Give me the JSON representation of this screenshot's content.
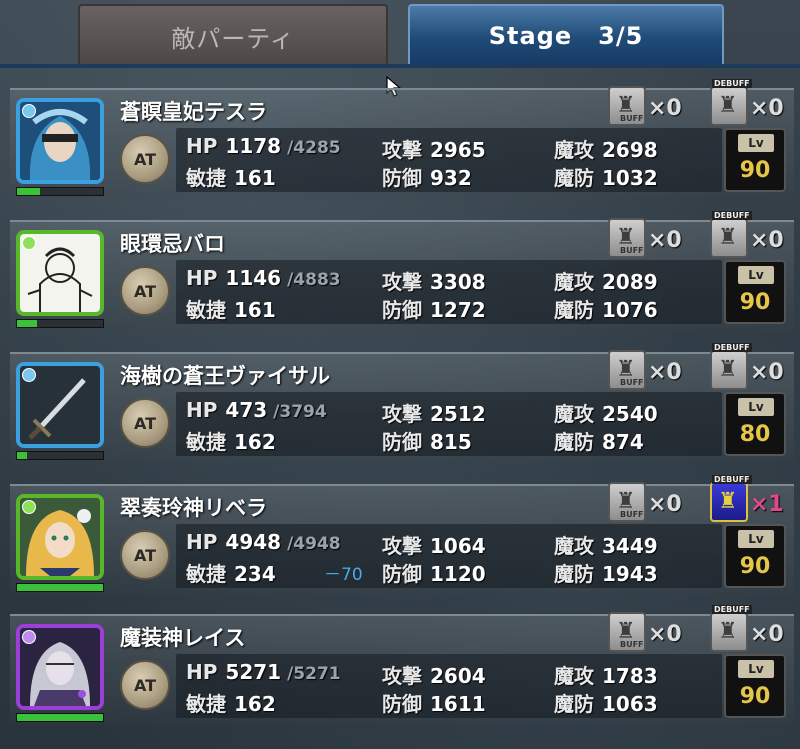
{
  "tabs": {
    "enemy_label": "敵パーティ",
    "stage_label": "Stage",
    "stage_value": "3/5"
  },
  "labels": {
    "hp": "HP",
    "agility": "敏捷",
    "attack": "攻撃",
    "defense": "防御",
    "magic_attack": "魔攻",
    "magic_defense": "魔防",
    "lv": "Lv",
    "at": "AT",
    "buff": "BUFF",
    "debuff": "DEBUFF"
  },
  "units": [
    {
      "name": "蒼瞑皇妃テスラ",
      "hp": "1178",
      "hp_max": "/4285",
      "agility": "161",
      "agility_mod": "",
      "attack": "2965",
      "defense": "932",
      "magic_attack": "2698",
      "magic_defense": "1032",
      "buff": "×0",
      "debuff": "×0",
      "level": "90",
      "hp_ratio": 0.27,
      "frame": "blue",
      "portrait_icon": "blindfolded-woman-portrait-icon"
    },
    {
      "name": "眼環忌バロ",
      "hp": "1146",
      "hp_max": "/4883",
      "agility": "161",
      "agility_mod": "",
      "attack": "3308",
      "defense": "1272",
      "magic_attack": "2089",
      "magic_defense": "1076",
      "buff": "×0",
      "debuff": "×0",
      "level": "90",
      "hp_ratio": 0.23,
      "frame": "green",
      "portrait_icon": "sketch-man-portrait-icon"
    },
    {
      "name": "海樹の蒼王ヴァイサル",
      "hp": "473",
      "hp_max": "/3794",
      "agility": "162",
      "agility_mod": "",
      "attack": "2512",
      "defense": "815",
      "magic_attack": "2540",
      "magic_defense": "874",
      "buff": "×0",
      "debuff": "×0",
      "level": "80",
      "hp_ratio": 0.12,
      "frame": "blue",
      "portrait_icon": "sword-portrait-icon"
    },
    {
      "name": "翠奏玲神リベラ",
      "hp": "4948",
      "hp_max": "/4948",
      "agility": "234",
      "agility_mod": "－70",
      "attack": "1064",
      "defense": "1120",
      "magic_attack": "3449",
      "magic_defense": "1943",
      "buff": "×0",
      "debuff": "×1",
      "level": "90",
      "hp_ratio": 1.0,
      "frame": "green",
      "portrait_icon": "blonde-girl-portrait-icon"
    },
    {
      "name": "魔装神レイス",
      "hp": "5271",
      "hp_max": "/5271",
      "agility": "162",
      "agility_mod": "",
      "attack": "2604",
      "defense": "1611",
      "magic_attack": "1783",
      "magic_defense": "1063",
      "buff": "×0",
      "debuff": "×0",
      "level": "90",
      "hp_ratio": 1.0,
      "frame": "purple",
      "portrait_icon": "armored-knight-portrait-icon"
    }
  ]
}
